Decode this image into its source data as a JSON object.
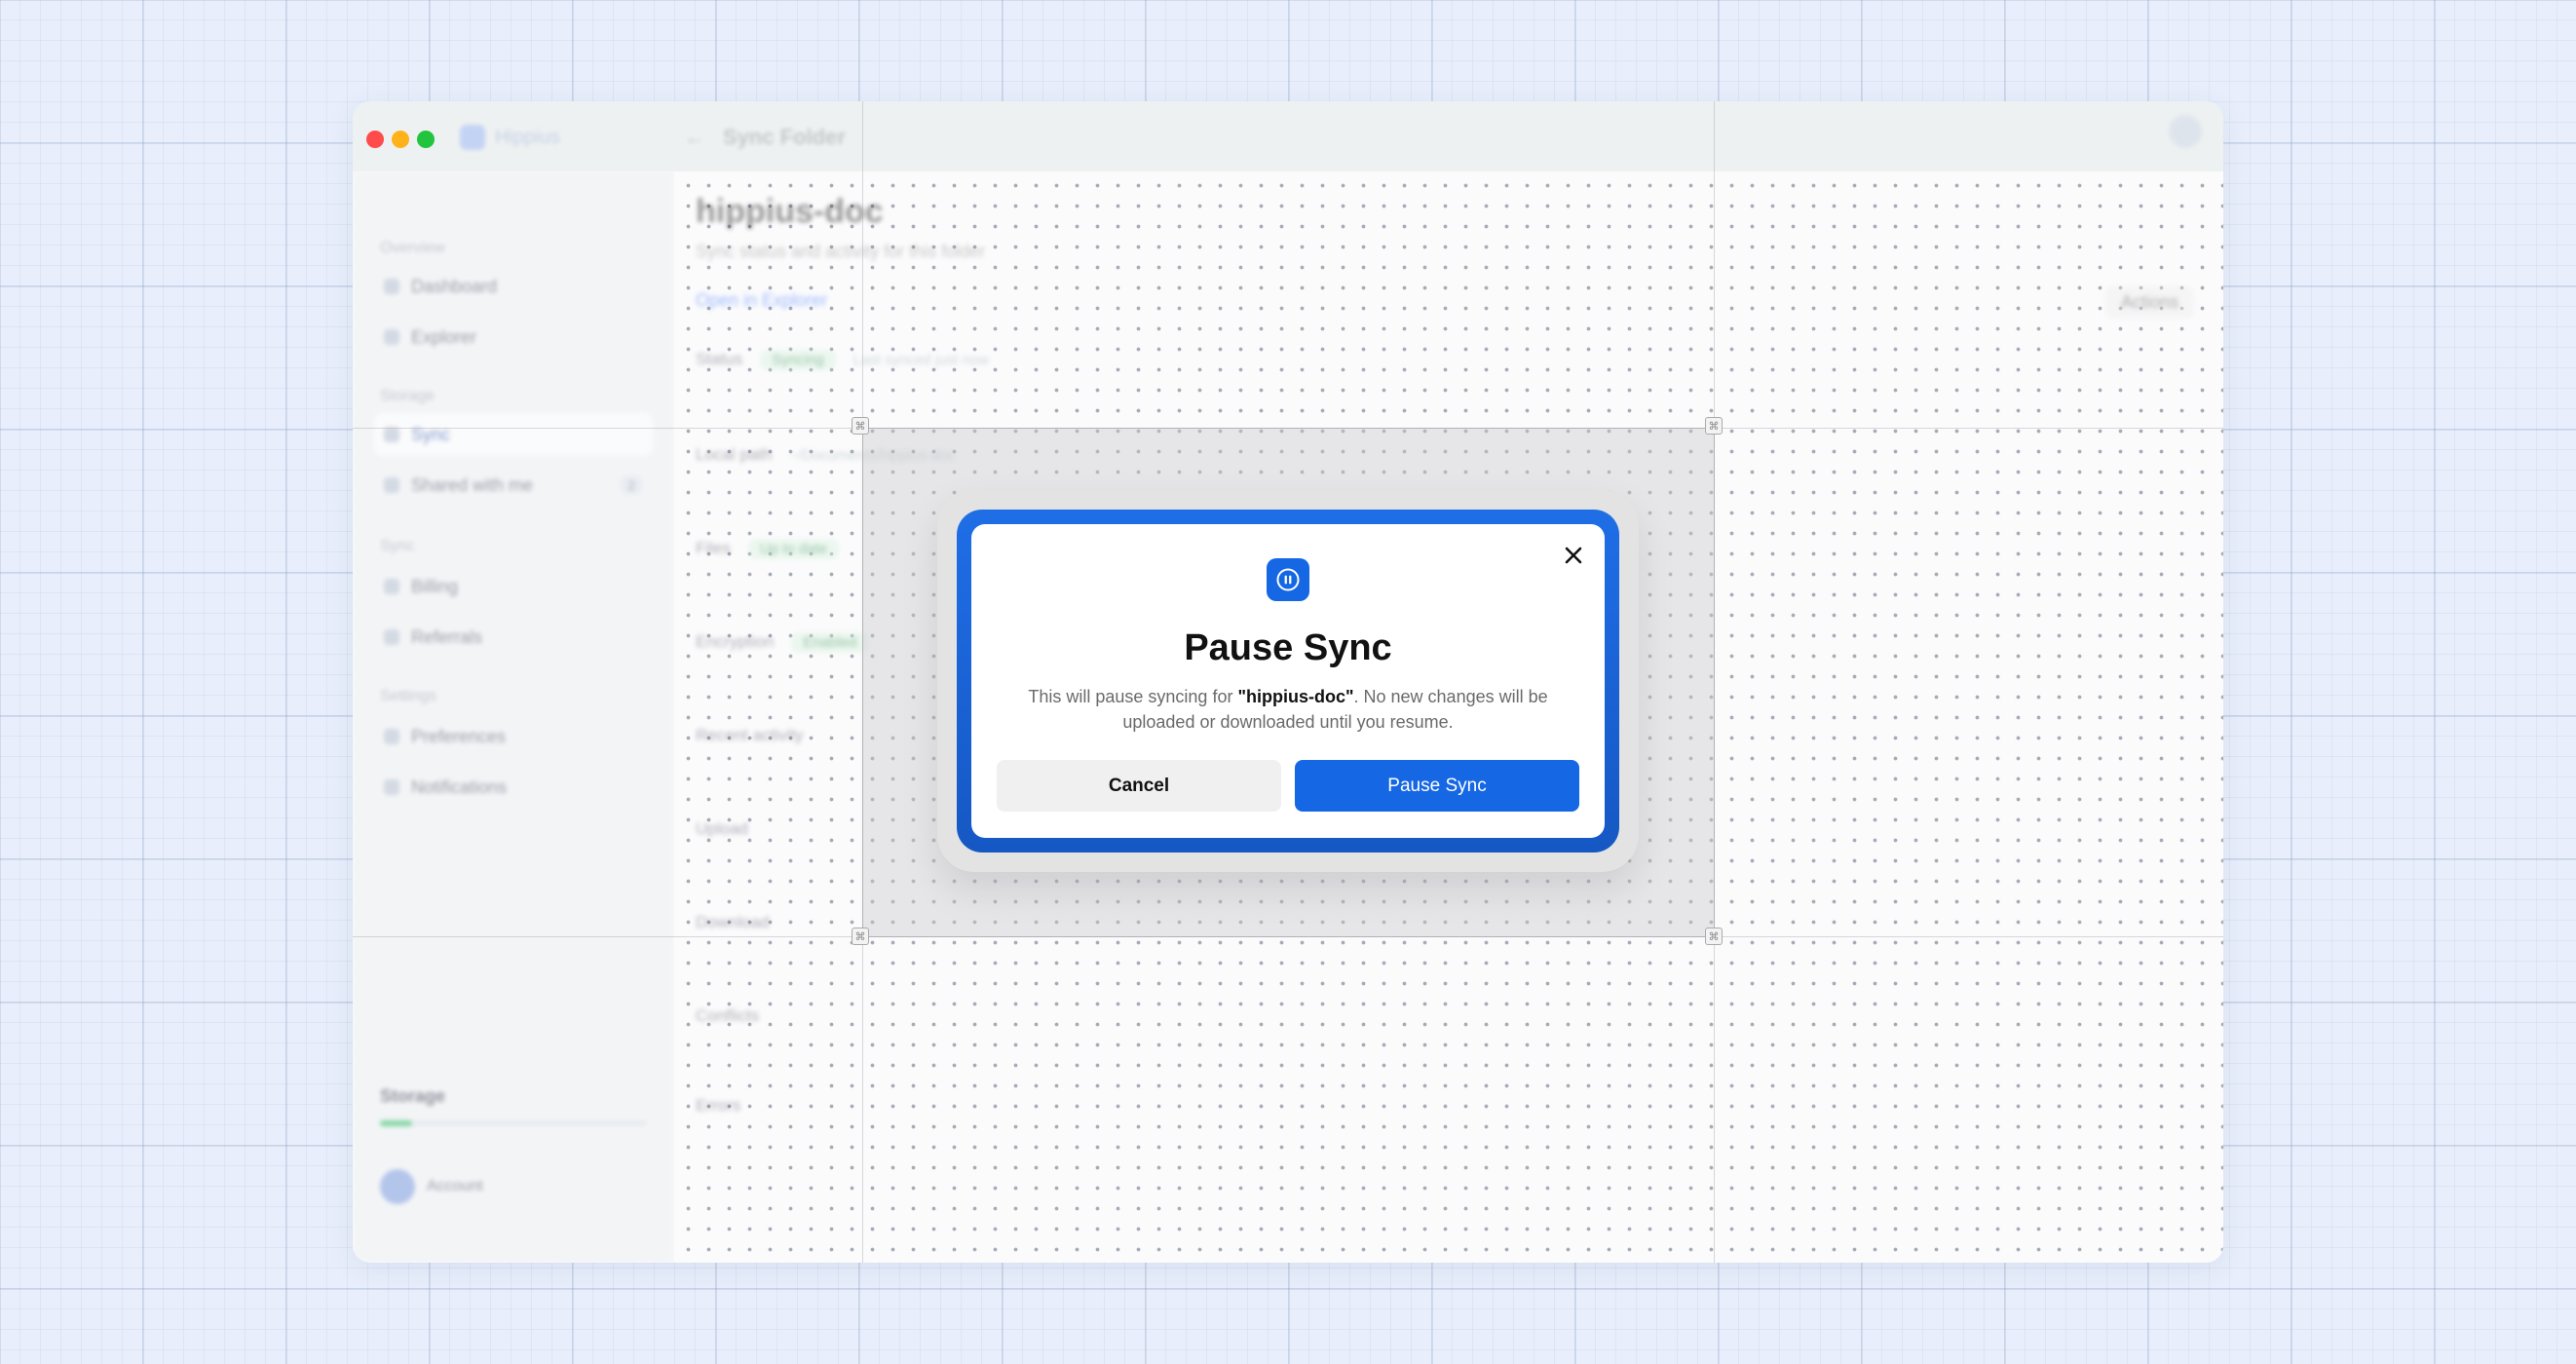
{
  "window": {
    "app_name": "Hippius",
    "title": "Sync Folder"
  },
  "sidebar": {
    "groups": [
      "Overview",
      "Storage",
      "Sync",
      "Settings"
    ],
    "items": [
      {
        "label": "Dashboard"
      },
      {
        "label": "Explorer"
      },
      {
        "label": "Sync"
      },
      {
        "label": "Shared with me",
        "badge": "2"
      },
      {
        "label": "Billing"
      },
      {
        "label": "Referrals"
      },
      {
        "label": "Preferences"
      },
      {
        "label": "Notifications"
      }
    ],
    "footer": {
      "title": "Storage",
      "progress": 0.12,
      "user": "Account"
    }
  },
  "main": {
    "page_title": "hippius-doc",
    "page_subtitle": "Sync status and activity for this folder",
    "link_label": "Open in Explorer",
    "action_label": "Actions",
    "rows": [
      {
        "name": "Status",
        "chip": "Syncing",
        "meta": "Last synced just now"
      },
      {
        "name": "Local path",
        "chip": "",
        "meta": "~/Documents/hippius-doc"
      },
      {
        "name": "Files",
        "chip": "Up to date",
        "meta": ""
      },
      {
        "name": "Encryption",
        "chip": "Enabled",
        "meta": ""
      },
      {
        "name": "Recent activity",
        "chip": "",
        "meta": ""
      },
      {
        "name": "Upload",
        "chip": "",
        "meta": ""
      },
      {
        "name": "Download",
        "chip": "",
        "meta": ""
      },
      {
        "name": "Conflicts",
        "chip": "",
        "meta": ""
      },
      {
        "name": "Errors",
        "chip": "",
        "meta": ""
      }
    ]
  },
  "dialog": {
    "icon": "pause-icon",
    "close_icon": "close-icon",
    "title": "Pause Sync",
    "message_prefix": "This will pause syncing for ",
    "folder_name": "\"hippius-doc\"",
    "message_suffix": ". No new changes will be uploaded or downloaded until you resume.",
    "cancel_label": "Cancel",
    "confirm_label": "Pause Sync"
  },
  "colors": {
    "accent": "#1567e4",
    "frame": "#1f6ee6",
    "traffic_red": "#ff4b4b",
    "traffic_yellow": "#ffb21a",
    "traffic_green": "#22c33d"
  }
}
